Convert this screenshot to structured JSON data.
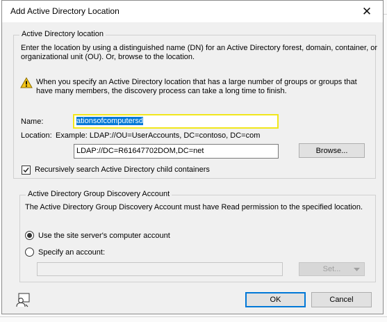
{
  "dialog": {
    "title": "Add Active Directory Location",
    "close_glyph": "✕"
  },
  "location_group": {
    "legend": "Active Directory location",
    "description_line1": "Enter the location by using a distinguished name (DN) for an Active Directory forest, domain, container, or",
    "description_line2": "organizational unit (OU). Or, browse to the location.",
    "warning_line1": "When you specify an Active Directory location that has a large number of groups or groups that",
    "warning_line2": "have many members, the discovery process can take a long time to finish.",
    "name_label": "Name:",
    "name_value": "ationsofcomputersd",
    "location_label": "Location:",
    "location_example": "Example: LDAP://OU=UserAccounts, DC=contoso, DC=com",
    "location_value": "LDAP://DC=R61647702DOM,DC=net",
    "browse_label": "Browse...",
    "recursive_label": "Recursively search Active Directory child containers",
    "recursive_checked": true
  },
  "account_group": {
    "legend": "Active Directory Group Discovery Account",
    "description": "The Active Directory Group Discovery Account must have Read permission to the specified location.",
    "option_site_server": "Use the site server's computer account",
    "option_specify": "Specify an account:",
    "selected_option": "site_server",
    "account_value": "",
    "set_label": "Set..."
  },
  "footer": {
    "ok_label": "OK",
    "cancel_label": "Cancel"
  },
  "icons": {
    "warning": "warning-icon",
    "help": "user-help-icon",
    "checkmark": "checkmark-icon",
    "dropdown": "caret-down-icon"
  },
  "colors": {
    "focus_outline": "#f1e71b",
    "selection": "#0078d7",
    "default_button_border": "#0078d7",
    "warning_yellow": "#f5c518"
  }
}
